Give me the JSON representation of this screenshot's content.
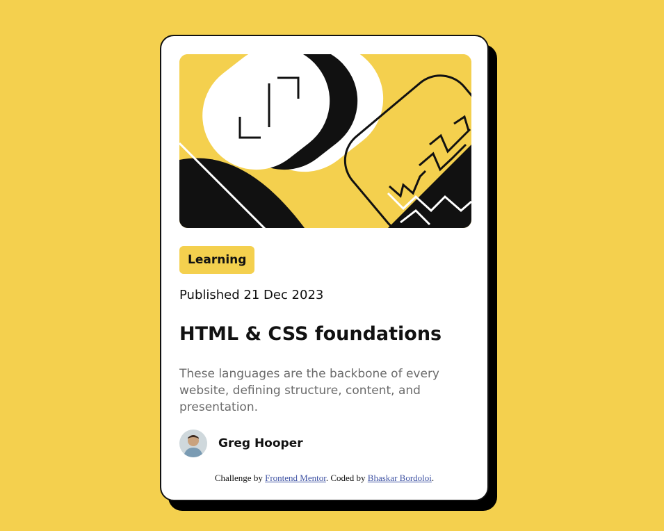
{
  "colors": {
    "page_background": "#F4D04E",
    "card_background": "#FFFFFF",
    "card_border": "#111111",
    "tag_background": "#F4D04E",
    "text_primary": "#111111",
    "text_muted": "#6B6B6B",
    "link": "#3E52A3"
  },
  "hero": {
    "icon": "abstract-illustration"
  },
  "card": {
    "tag": "Learning",
    "published": "Published 21 Dec 2023",
    "title": "HTML & CSS foundations",
    "description": "These languages are the backbone of every website, defining structure, content, and presentation.",
    "author": {
      "name": "Greg Hooper",
      "avatar_icon": "avatar-photo"
    }
  },
  "attribution": {
    "prefix": "Challenge by ",
    "link1": "Frontend Mentor",
    "middle": ". Coded by ",
    "link2": "Bhaskar Bordoloi",
    "suffix": "."
  }
}
